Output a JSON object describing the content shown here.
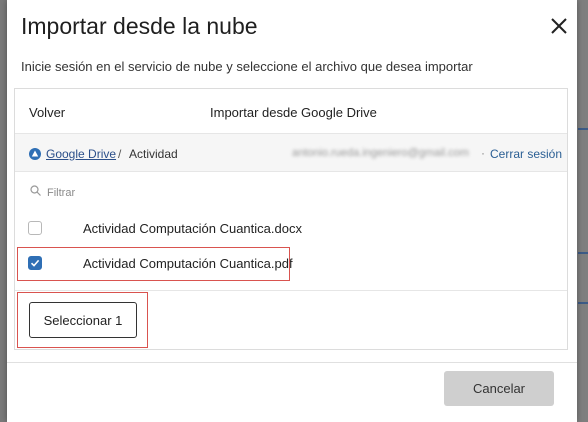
{
  "dialog": {
    "title": "Importar desde la nube",
    "subtitle": "Inicie sesión en el servicio de nube y seleccione el archivo que desea importar",
    "close_icon": "close-icon"
  },
  "panel": {
    "back_label": "Volver",
    "title": "Importar desde Google Drive"
  },
  "breadcrumb": {
    "service_icon": "google-drive-icon",
    "service": "Google Drive",
    "separator": "/",
    "current": "Actividad",
    "account": "antonio.rueda.ingeniero@gmail.com",
    "dot": "·",
    "logout": "Cerrar sesión"
  },
  "filter": {
    "icon": "search-icon",
    "placeholder": "Filtrar"
  },
  "files": [
    {
      "name": "Actividad Computación Cuantica.docx",
      "checked": false
    },
    {
      "name": "Actividad Computación Cuantica.pdf",
      "checked": true
    }
  ],
  "actions": {
    "select_label": "Seleccionar 1",
    "cancel_label": "Cancelar"
  },
  "colors": {
    "accent": "#2f6fb5",
    "link": "#2b5f94",
    "highlight": "#d9534f",
    "disabled_button": "#cfcfcf"
  }
}
